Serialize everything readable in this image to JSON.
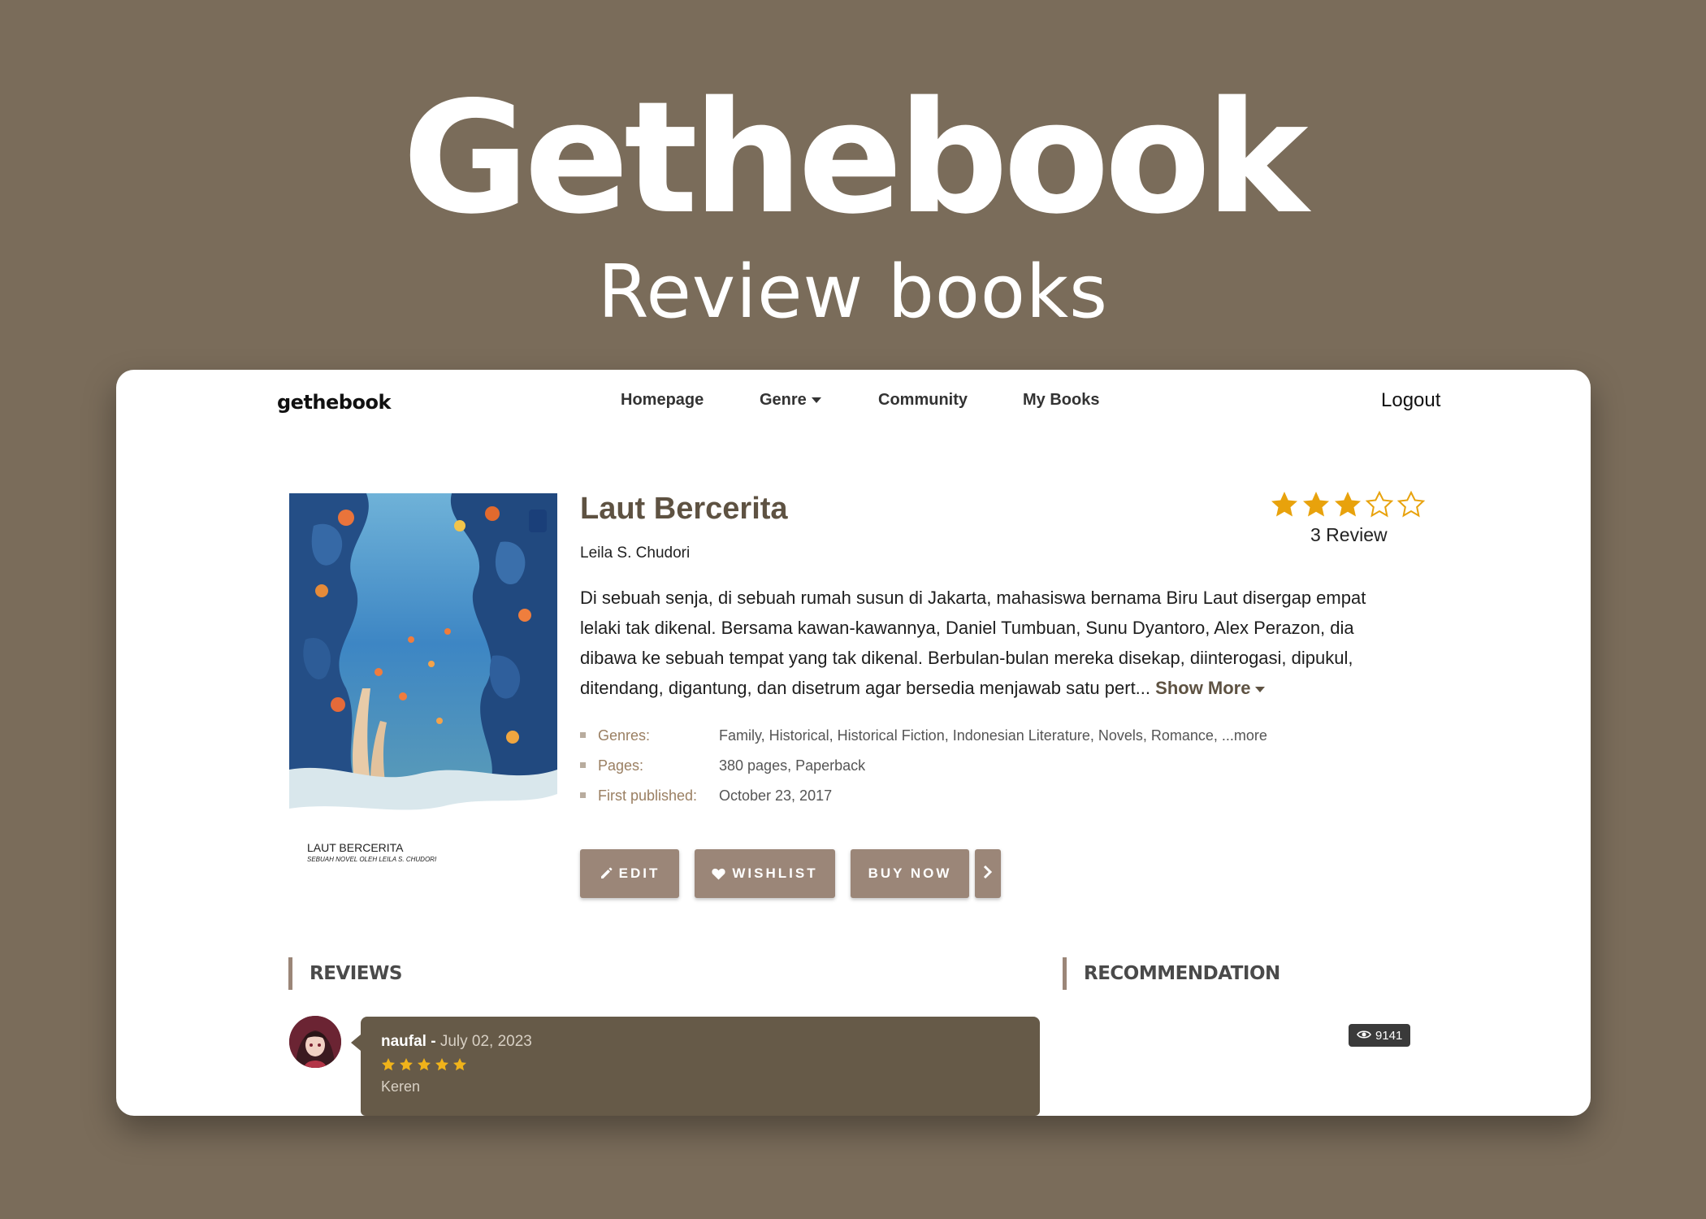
{
  "hero": {
    "title": "Gethebook",
    "subtitle": "Review books"
  },
  "nav": {
    "brand": "gethebook",
    "items": [
      {
        "label": "Homepage"
      },
      {
        "label": "Genre"
      },
      {
        "label": "Community"
      },
      {
        "label": "My Books"
      }
    ],
    "logout": "Logout"
  },
  "book": {
    "cover": {
      "title": "LAUT BERCERITA",
      "subtitle": "SEBUAH NOVEL OLEH LEILA S. CHUDORI"
    },
    "title": "Laut Bercerita",
    "author": "Leila S. Chudori",
    "rating": {
      "value": 3,
      "max": 5,
      "review_count": "3 Review"
    },
    "description": "Di sebuah senja, di sebuah rumah susun di Jakarta, mahasiswa bernama Biru Laut disergap empat lelaki tak dikenal. Bersama kawan-kawannya, Daniel Tumbuan, Sunu Dyantoro, Alex Perazon, dia dibawa ke sebuah tempat yang tak dikenal. Berbulan-bulan mereka disekap, diinterogasi, dipukul, ditendang, digantung, dan disetrum agar bersedia menjawab satu pert...",
    "show_more": "Show More",
    "meta": [
      {
        "key": "Genres:",
        "value": "Family, Historical, Historical Fiction, Indonesian Literature, Novels, Romance, ...more"
      },
      {
        "key": "Pages:",
        "value": "380 pages, Paperback"
      },
      {
        "key": "First published:",
        "value": "October 23, 2017"
      }
    ]
  },
  "actions": {
    "edit": "EDIT",
    "wishlist": "WISHLIST",
    "buy": "BUY NOW"
  },
  "sections": {
    "reviews": "REVIEWS",
    "recommendation": "RECOMMENDATION"
  },
  "review": {
    "user": "naufal",
    "separator": " - ",
    "date": "July 02, 2023",
    "rating": 5,
    "text": "Keren"
  },
  "recommendation": {
    "views": "9141"
  },
  "colors": {
    "background": "#7a6c5a",
    "accent": "#9b8678",
    "star": "#e8a20c",
    "bubble": "#665a48"
  }
}
